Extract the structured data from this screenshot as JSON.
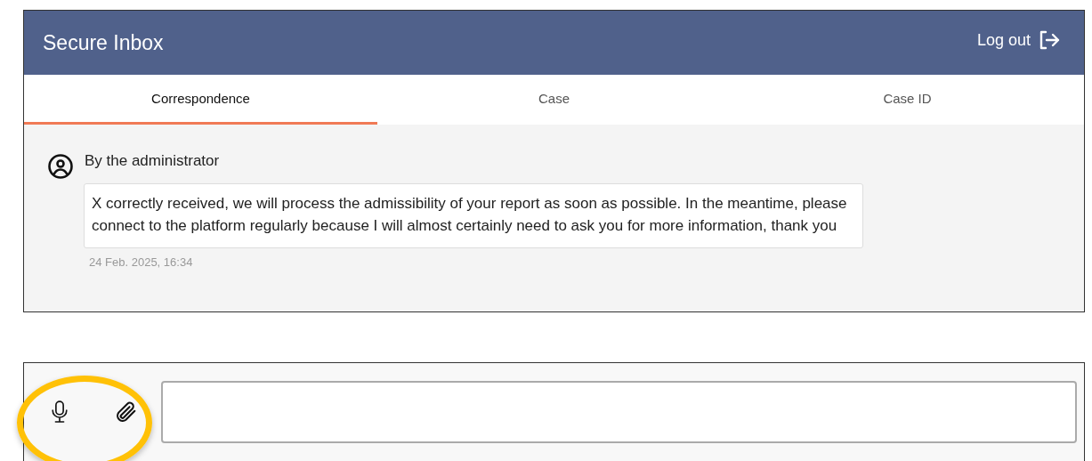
{
  "header": {
    "title": "Secure Inbox",
    "logout": "Log out"
  },
  "tabs": [
    {
      "label": "Correspondence",
      "selected": true
    },
    {
      "label": "Case",
      "selected": false
    },
    {
      "label": "Case ID",
      "selected": false
    }
  ],
  "messages": [
    {
      "author": "By the administrator",
      "text": "X correctly received, we will process the admissibility of your report as soon as possible. In the meantime, please connect to the platform regularly because I will almost certainly need to ask you for more information, thank you",
      "time": "24 Feb. 2025, 16:34"
    }
  ]
}
